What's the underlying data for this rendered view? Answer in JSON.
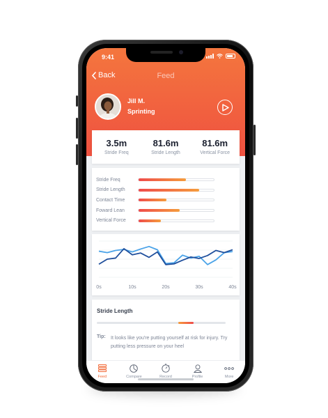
{
  "status": {
    "time": "9:41"
  },
  "nav": {
    "back_label": "Back",
    "title": "Feed"
  },
  "user": {
    "name": "Jill M.",
    "activity": "Sprinting"
  },
  "stats": [
    {
      "value": "3.5m",
      "label": "Stride Freq"
    },
    {
      "value": "81.6m",
      "label": "Stride Length"
    },
    {
      "value": "81.6m",
      "label": "Vertical Force"
    }
  ],
  "metrics": [
    {
      "label": "Stride Freq",
      "level": 0.63
    },
    {
      "label": "Stride Length",
      "level": 0.81
    },
    {
      "label": "Contact Time",
      "level": 0.37
    },
    {
      "label": "Foward Lean",
      "level": 0.55
    },
    {
      "label": "Vertical Force",
      "level": 0.3
    }
  ],
  "chart_data": {
    "type": "line",
    "x": [
      0,
      2.5,
      5,
      7.5,
      10,
      12.5,
      15,
      17.5,
      20,
      22.5,
      25,
      27.5,
      30,
      32.5,
      35,
      37.5,
      40
    ],
    "x_ticks": [
      "0s",
      "10s",
      "20s",
      "30s",
      "40s"
    ],
    "xlim": [
      0,
      40
    ],
    "ylim": [
      0,
      10
    ],
    "series": [
      {
        "color": "#4aa3e8",
        "values": [
          7.2,
          6.8,
          7.4,
          7.7,
          7.0,
          7.8,
          8.5,
          7.6,
          3.8,
          4.0,
          6.1,
          5.3,
          5.8,
          3.5,
          4.8,
          6.8,
          7.1
        ]
      },
      {
        "color": "#1f4f9c",
        "values": [
          3.6,
          5.0,
          5.3,
          7.9,
          6.2,
          6.7,
          5.5,
          7.0,
          3.5,
          3.7,
          4.7,
          5.6,
          5.2,
          6.0,
          7.4,
          6.8,
          7.6
        ]
      }
    ],
    "grid": true
  },
  "stride_length": {
    "title": "Stride Length",
    "range_start": 0.63,
    "range_end": 0.75
  },
  "tip": {
    "label": "Tip:",
    "text": "It looks like you're putting yourself at risk for injury. Try putting less pressure on your heel"
  },
  "tabs": [
    {
      "label": "Feed",
      "icon": "feed-icon",
      "active": true
    },
    {
      "label": "Compare",
      "icon": "compare-icon",
      "active": false
    },
    {
      "label": "Record",
      "icon": "record-icon",
      "active": false
    },
    {
      "label": "Profile",
      "icon": "profile-icon",
      "active": false
    },
    {
      "label": "More",
      "icon": "more-icon",
      "active": false
    }
  ],
  "colors": {
    "accent": "#f26b3a",
    "hero_top": "#f4763e",
    "hero_bottom": "#ef5140"
  }
}
